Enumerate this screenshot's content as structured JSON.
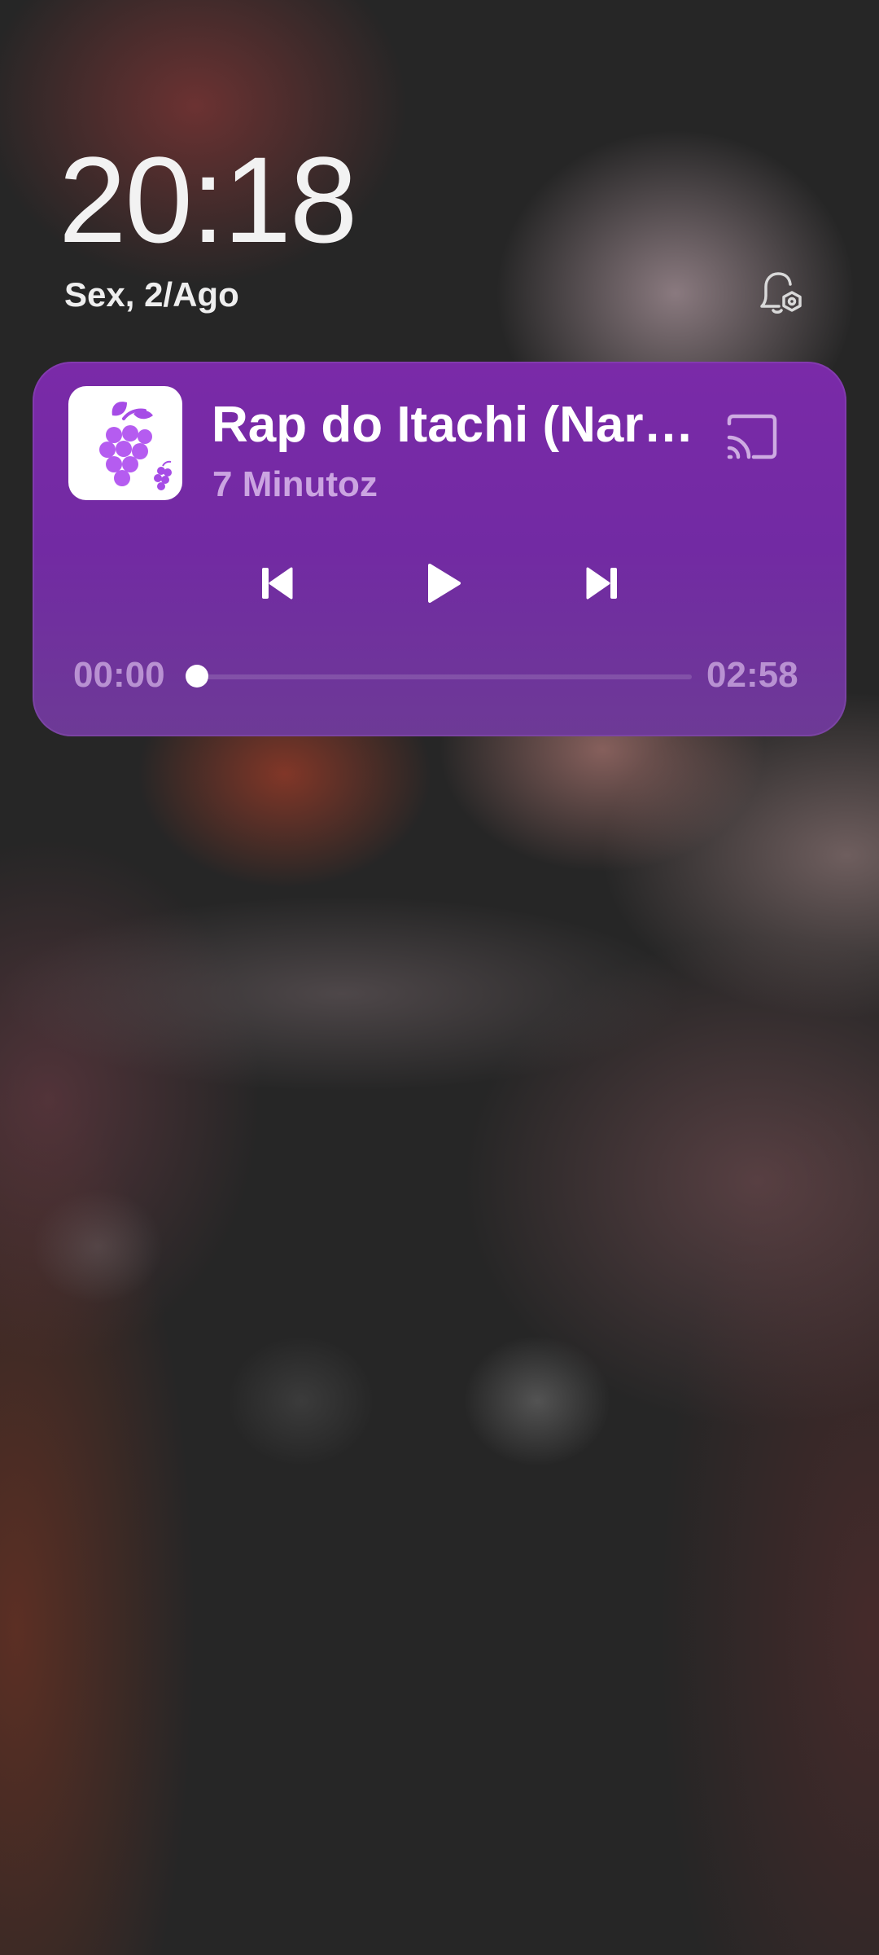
{
  "lockscreen": {
    "time": "20:18",
    "date": "Sex, 2/Ago",
    "notification_settings_icon": "bell-gear-icon"
  },
  "media": {
    "title": "Rap do Itachi (Naruto)",
    "artist": "7 Minutoz",
    "app_icon": "grapes-icon",
    "cast_icon": "cast-icon",
    "controls": {
      "previous_icon": "skip-previous-icon",
      "play_icon": "play-icon",
      "next_icon": "skip-next-icon"
    },
    "elapsed": "00:00",
    "duration": "02:58",
    "progress_fraction": 0.0
  },
  "colors": {
    "card": "#7a2aa8",
    "artwork_accent": "#a64ce6"
  }
}
